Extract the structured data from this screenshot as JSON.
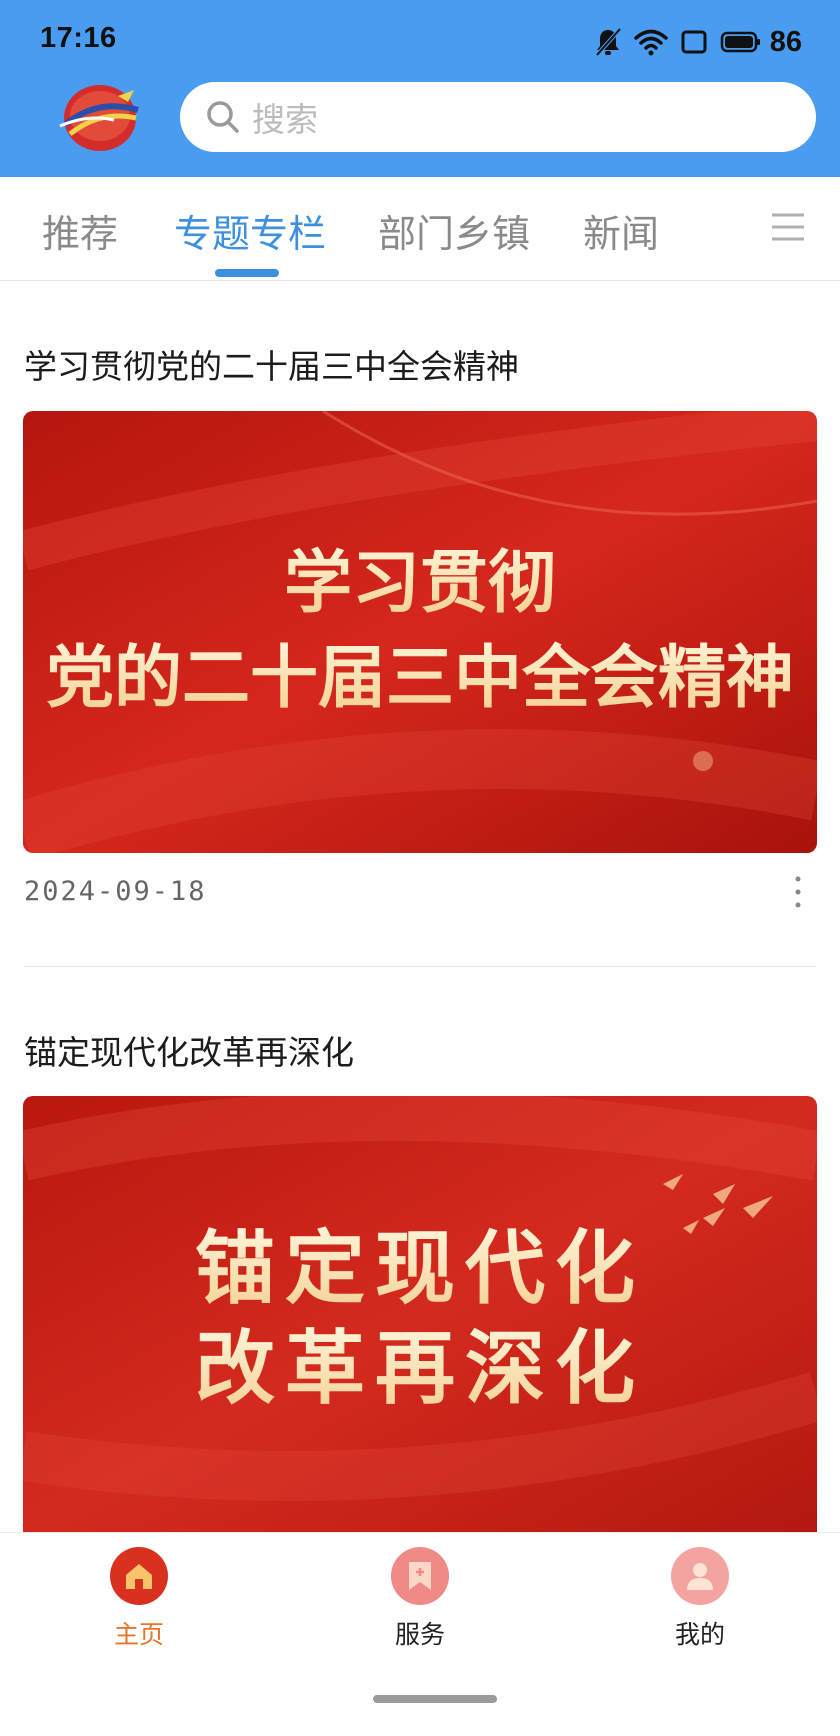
{
  "status_bar": {
    "time": "17:16",
    "battery": "86"
  },
  "header": {
    "search_placeholder": "搜索"
  },
  "tabs": [
    {
      "label": "推荐"
    },
    {
      "label": "专题专栏",
      "active": true
    },
    {
      "label": "部门乡镇"
    },
    {
      "label": "新闻"
    }
  ],
  "articles": [
    {
      "title": "学习贯彻党的二十届三中全会精神",
      "banner_lines": [
        "学习贯彻",
        "党的二十届三中全会精神"
      ],
      "date": "2024-09-18"
    },
    {
      "title": "锚定现代化改革再深化",
      "banner_lines": [
        "锚定现代化",
        "改革再深化"
      ]
    }
  ],
  "bottom_nav": [
    {
      "label": "主页",
      "icon": "home-icon",
      "active": true
    },
    {
      "label": "服务",
      "icon": "bookmark-service-icon"
    },
    {
      "label": "我的",
      "icon": "user-icon"
    }
  ],
  "colors": {
    "header_blue": "#4a9cf0",
    "tab_active": "#3d8fe0",
    "nav_active": "#e8742a",
    "banner_red": "#c8201c"
  }
}
